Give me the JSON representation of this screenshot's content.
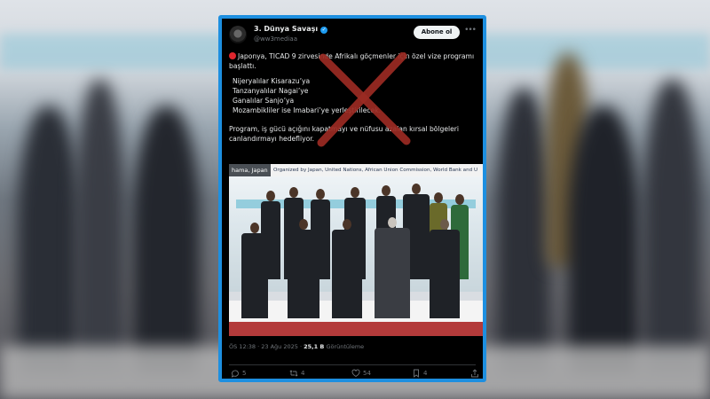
{
  "tweet": {
    "account_name": "3. Dünya Savaşı",
    "handle": "@ww3mediaa",
    "follow_label": "Abone ol",
    "more_icon": "more-icon",
    "text_intro": "Japonya, TICAD 9 zirvesinde Afrikalı göçmenler için özel vize programı başlattı.",
    "bullets": [
      "Nijeryalılar Kisarazu’ya",
      "Tanzanyalılar Nagai’ye",
      "Ganalılar Sanjo’ya",
      "Mozambikliler ise Imabari’ye yerleştirilecek."
    ],
    "text_outro": "Program, iş gücü açığını kapatmayı ve nüfusu azalan kırsal bölgeleri canlandırmayı hedefliyor.",
    "photo": {
      "location_tag": "hama, Japan",
      "organizer_caption": "Organized by Japan, United Nations, African Union Commission, World Bank and U"
    },
    "time": "ÖS 12:38",
    "date": "23 Ağu 2025",
    "views_count": "25,1 B",
    "views_label": "Görüntüleme",
    "actions": {
      "replies": "5",
      "reposts": "4",
      "likes": "54",
      "bookmarks": "4"
    }
  },
  "colors": {
    "card_border": "#1d8fe0",
    "cross": "#9c2b23",
    "red_dot": "#e0262e",
    "verified": "#1d9bf0"
  }
}
